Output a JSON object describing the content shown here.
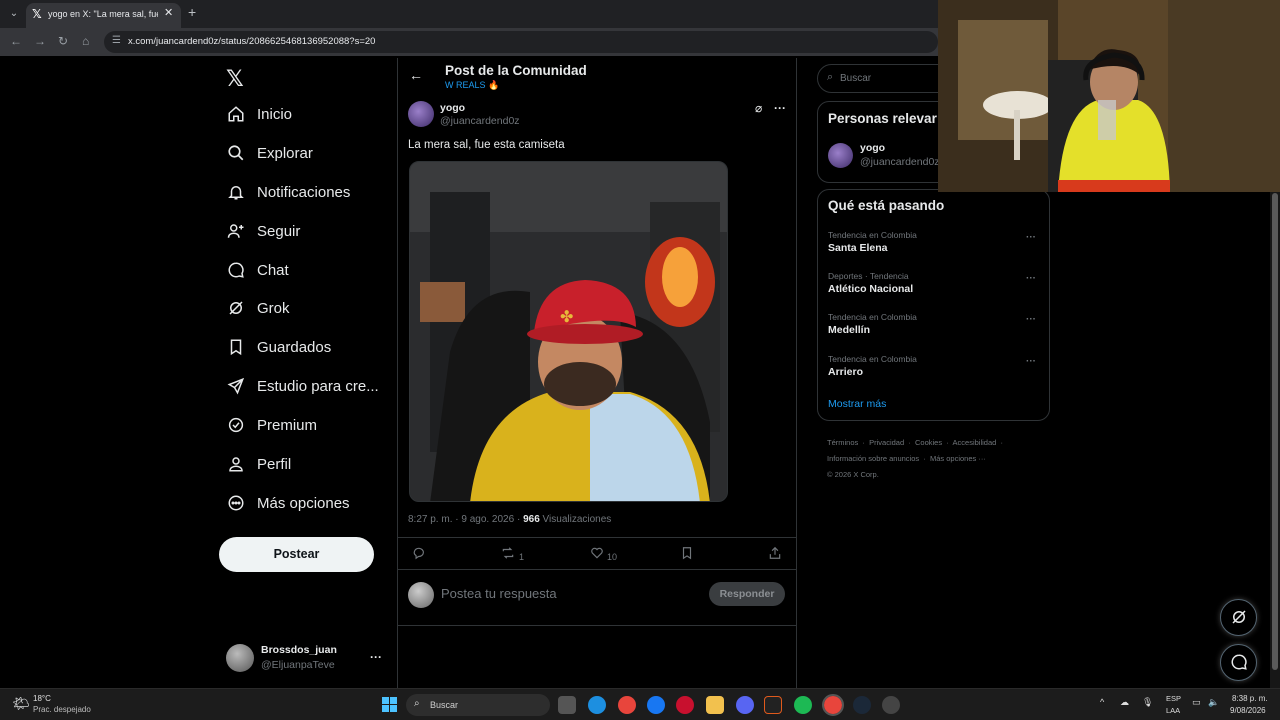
{
  "browser": {
    "tab_title": "yogo en X: \"La mera sal, fue est",
    "url": "x.com/juancardend0z/status/2086625468136952088?s=20"
  },
  "nav": {
    "items": [
      {
        "label": "Inicio",
        "icon": "home-icon"
      },
      {
        "label": "Explorar",
        "icon": "search-icon"
      },
      {
        "label": "Notificaciones",
        "icon": "bell-icon"
      },
      {
        "label": "Seguir",
        "icon": "add-person-icon"
      },
      {
        "label": "Chat",
        "icon": "chat-icon"
      },
      {
        "label": "Grok",
        "icon": "grok-icon"
      },
      {
        "label": "Guardados",
        "icon": "bookmark-icon"
      },
      {
        "label": "Estudio para cre...",
        "icon": "rocket-icon"
      },
      {
        "label": "Premium",
        "icon": "verified-icon"
      },
      {
        "label": "Perfil",
        "icon": "person-icon"
      },
      {
        "label": "Más opciones",
        "icon": "more-circle-icon"
      }
    ],
    "post_button": "Postear",
    "account": {
      "name": "Brossdos_juan",
      "handle": "@EljuanpaTeve"
    }
  },
  "header": {
    "title": "Post de la Comunidad",
    "community": "W REALS 🔥"
  },
  "post": {
    "author_name": "yogo",
    "author_handle": "@juancardend0z",
    "text": "La mera sal, fue esta camiseta",
    "time": "8:27 p. m. · 9 ago. 2026 · ",
    "views_count": "966",
    "views_label": " Visualizaciones",
    "reposts": "1",
    "likes": "10",
    "reply_placeholder": "Postea tu respuesta",
    "reply_button": "Responder"
  },
  "sidebar": {
    "search_placeholder": "Buscar",
    "relevant_title": "Personas relevar",
    "relevant_person": {
      "name": "yogo",
      "handle": "@juancardend0z"
    },
    "trends_title": "Qué está pasando",
    "trends": [
      {
        "context": "Tendencia en Colombia",
        "name": "Santa Elena"
      },
      {
        "context": "Deportes · Tendencia",
        "name": "Atlético Nacional"
      },
      {
        "context": "Tendencia en Colombia",
        "name": "Medellín"
      },
      {
        "context": "Tendencia en Colombia",
        "name": "Arriero"
      }
    ],
    "show_more": "Mostrar más",
    "footer_links": [
      "Términos",
      "Privacidad",
      "Cookies",
      "Accesibilidad",
      "Información sobre anuncios",
      "Más opciones ···"
    ],
    "copyright": "© 2026 X Corp."
  },
  "taskbar": {
    "temperature": "18°C",
    "condition": "Prac. despejado",
    "search": "Buscar",
    "lang_top": "ESP",
    "lang_bottom": "LAA",
    "time": "8:38 p. m.",
    "date": "9/08/2026"
  },
  "colors": {
    "accent": "#1d9bf0",
    "background": "#000000",
    "border": "#2f3336"
  }
}
